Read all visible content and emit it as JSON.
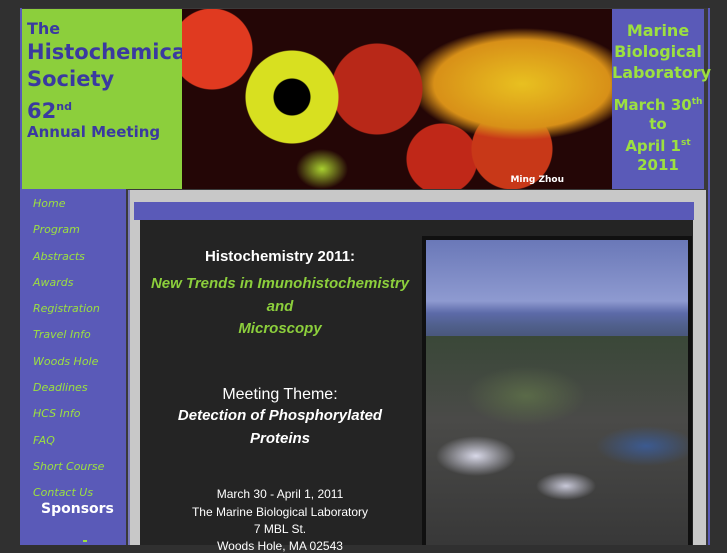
{
  "header": {
    "title_line1": "The",
    "title_line2": "Histochemical",
    "title_line3": "Society",
    "title_number": "62",
    "title_suffix": "nd",
    "title_line4": "Annual Meeting",
    "photo_credit": "Ming Zhou",
    "venue_line1": "Marine",
    "venue_line2": "Biological",
    "venue_line3": "Laboratory",
    "date_line1": "March 30",
    "date_sup1": "th",
    "date_line2": "to",
    "date_line3": "April 1",
    "date_sup3": "st",
    "date_line4": "2011"
  },
  "sidebar": {
    "items": [
      {
        "label": "Home"
      },
      {
        "label": "Program"
      },
      {
        "label": "Abstracts"
      },
      {
        "label": "Awards"
      },
      {
        "label": "Registration"
      },
      {
        "label": "Travel Info"
      },
      {
        "label": "Woods Hole"
      },
      {
        "label": "Deadlines"
      },
      {
        "label": "HCS Info"
      },
      {
        "label": "FAQ"
      },
      {
        "label": "Short Course"
      },
      {
        "label": "Contact Us"
      }
    ],
    "sponsors_heading": "Sponsors"
  },
  "main": {
    "heading": "Histochemistry 2011:",
    "subtitle_line1": "New Trends in Imunohistochemistry",
    "subtitle_line2": "and",
    "subtitle_line3": "Microscopy",
    "theme_label": "Meeting Theme:",
    "theme_line1": "Detection of Phosphorylated",
    "theme_line2": "Proteins",
    "dates": "March 30 - April 1, 2011",
    "venue": "The Marine Biological Laboratory",
    "address1": "7 MBL St.",
    "address2": "Woods Hole, MA 02543"
  },
  "colors": {
    "accent_green": "#8ccf3c",
    "accent_blue": "#5a5ab8",
    "title_blue": "#3a3aa0"
  }
}
